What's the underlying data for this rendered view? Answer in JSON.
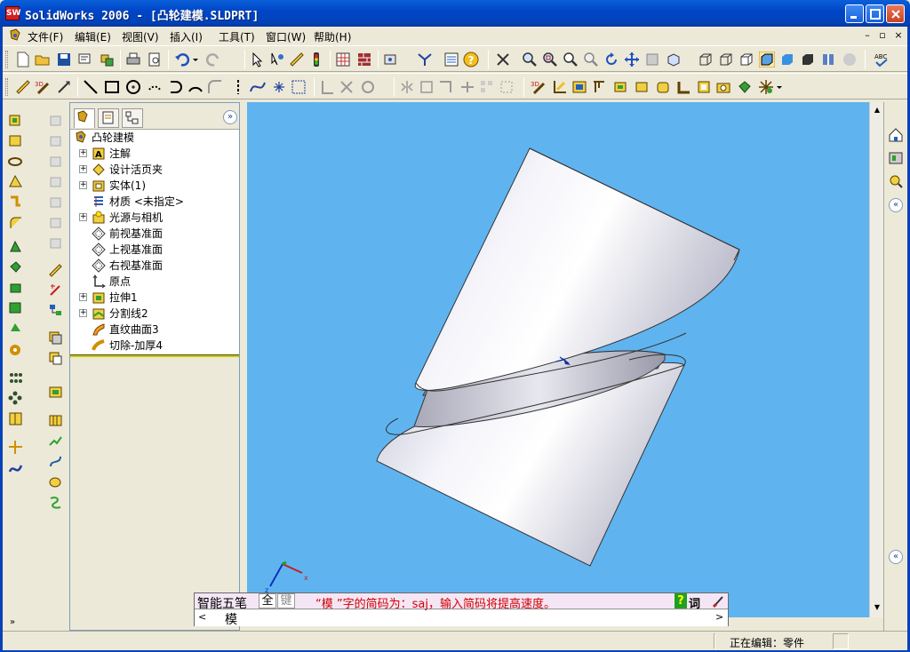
{
  "window": {
    "title": "SolidWorks 2006 - [凸轮建模.SLDPRT]",
    "app_icon_text": "SW"
  },
  "menu": {
    "items": [
      "文件(F)",
      "编辑(E)",
      "视图(V)",
      "插入(I)",
      "工具(T)",
      "窗口(W)",
      "帮助(H)"
    ]
  },
  "tree": {
    "root": "凸轮建模",
    "items": [
      {
        "label": "注解",
        "icon": "annotations-icon",
        "expandable": true
      },
      {
        "label": "设计活页夹",
        "icon": "design-binder-icon",
        "expandable": true
      },
      {
        "label": "实体(1)",
        "icon": "solid-bodies-icon",
        "expandable": true
      },
      {
        "label": "材质 <未指定>",
        "icon": "material-icon",
        "expandable": false
      },
      {
        "label": "光源与相机",
        "icon": "lights-cameras-icon",
        "expandable": true
      },
      {
        "label": "前视基准面",
        "icon": "plane-icon",
        "expandable": false
      },
      {
        "label": "上视基准面",
        "icon": "plane-icon",
        "expandable": false
      },
      {
        "label": "右视基准面",
        "icon": "plane-icon",
        "expandable": false
      },
      {
        "label": "原点",
        "icon": "origin-icon",
        "expandable": false
      },
      {
        "label": "拉伸1",
        "icon": "extrude-icon",
        "expandable": true
      },
      {
        "label": "分割线2",
        "icon": "split-line-icon",
        "expandable": true
      },
      {
        "label": "直纹曲面3",
        "icon": "ruled-surface-icon",
        "expandable": false
      },
      {
        "label": "切除-加厚4",
        "icon": "thicken-cut-icon",
        "expandable": false
      }
    ]
  },
  "ime": {
    "name": "智能五笔",
    "full_btn": "全",
    "key_btn": "键",
    "message": "“模 ”字的简码为：saj，输入简码将提高速度。",
    "candidate": "模",
    "help_btn": "?",
    "ci_btn": "词"
  },
  "status": {
    "text": "正在编辑：零件"
  },
  "colors": {
    "viewport_bg": "#5fb4f0",
    "titlebar": "#0046c8",
    "ime_msg": "#d00000"
  }
}
